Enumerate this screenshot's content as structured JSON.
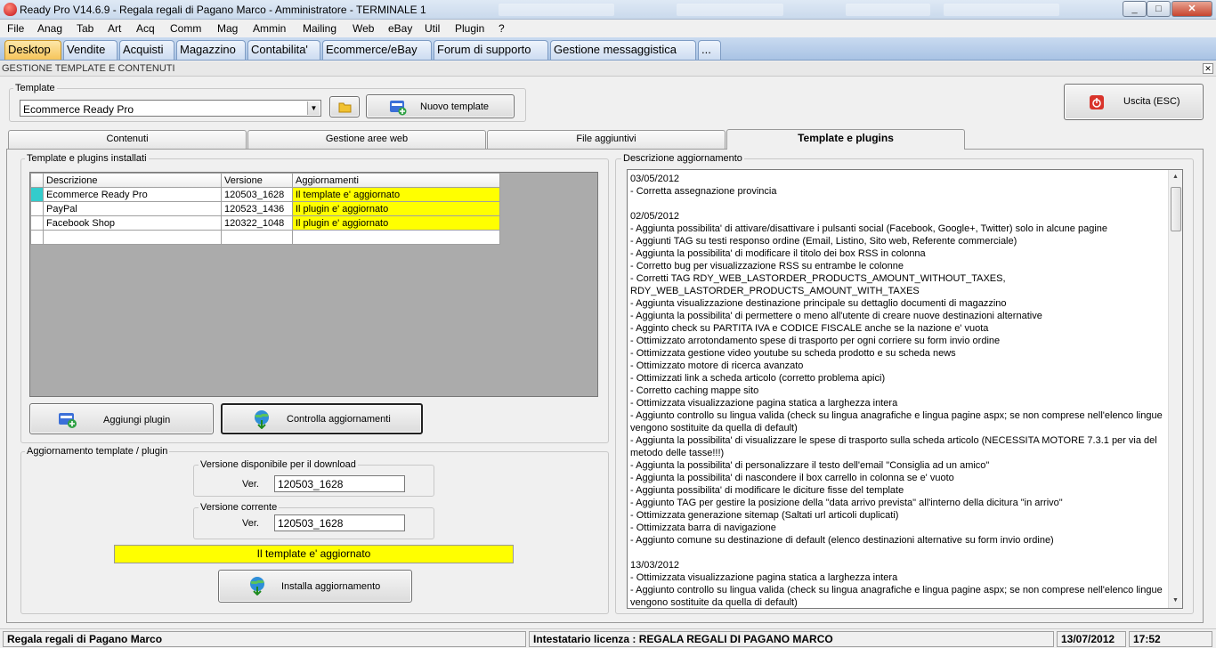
{
  "window": {
    "title": "Ready Pro V14.6.9 - Regala regali di Pagano Marco - Amministratore - TERMINALE 1",
    "controls": [
      "_",
      "□",
      "✕"
    ]
  },
  "menu": [
    "File",
    "Anag",
    "Tab",
    "Art",
    "Acq",
    "Comm",
    "Mag",
    "Ammin",
    "Mailing",
    "Web",
    "eBay",
    "Util",
    "Plugin",
    "?"
  ],
  "main_tabs": [
    "Desktop",
    "Vendite",
    "Acquisti",
    "Magazzino",
    "Contabilita'",
    "Ecommerce/eBay",
    "Forum di supporto",
    "Gestione messaggistica",
    "..."
  ],
  "section_title": "GESTIONE TEMPLATE E CONTENUTI",
  "template_group": {
    "legend": "Template",
    "selected": "Ecommerce Ready Pro",
    "new_button": "Nuovo template"
  },
  "exit_button": "Uscita (ESC)",
  "page_tabs": [
    "Contenuti",
    "Gestione aree web",
    "File aggiuntivi",
    "Template e plugins"
  ],
  "installed": {
    "legend": "Template e plugins installati",
    "columns": [
      "Descrizione",
      "Versione",
      "Aggiornamenti"
    ],
    "rows": [
      {
        "descrizione": "Ecommerce Ready Pro",
        "versione": "120503_1628",
        "aggiornamenti": "Il template e' aggiornato"
      },
      {
        "descrizione": "PayPal",
        "versione": "120523_1436",
        "aggiornamenti": "Il plugin e' aggiornato"
      },
      {
        "descrizione": "Facebook Shop",
        "versione": "120322_1048",
        "aggiornamenti": "Il plugin e' aggiornato"
      }
    ],
    "add_button": "Aggiungi plugin",
    "check_button": "Controlla aggiornamenti"
  },
  "update": {
    "legend": "Aggiornamento template / plugin",
    "available_legend": "Versione disponibile per il download",
    "current_legend": "Versione corrente",
    "ver_label": "Ver.",
    "available_value": "120503_1628",
    "current_value": "120503_1628",
    "status": "Il template e' aggiornato",
    "install_button": "Installa aggiornamento"
  },
  "description": {
    "legend": "Descrizione aggiornamento",
    "text": "03/05/2012\n- Corretta assegnazione provincia\n\n02/05/2012\n- Aggiunta possibilita' di attivare/disattivare i pulsanti social (Facebook, Google+, Twitter) solo in alcune pagine\n- Aggiunti TAG su testi responso ordine (Email, Listino, Sito web, Referente commerciale)\n- Aggiunta la possibilita' di modificare il titolo dei box RSS in colonna\n- Corretto bug per visualizzazione RSS su entrambe le colonne\n- Corretti TAG RDY_WEB_LASTORDER_PRODUCTS_AMOUNT_WITHOUT_TAXES,\nRDY_WEB_LASTORDER_PRODUCTS_AMOUNT_WITH_TAXES\n- Aggiunta visualizzazione destinazione principale su dettaglio documenti di magazzino\n- Aggiunta la possibilita' di permettere o meno all'utente di creare nuove destinazioni alternative\n- Agginto check su PARTITA IVA e CODICE FISCALE anche se la nazione e' vuota\n- Ottimizzato arrotondamento spese di trasporto per ogni corriere su form invio ordine\n- Ottimizzata gestione video youtube su scheda prodotto e su scheda news\n- Ottimizzato motore di ricerca avanzato\n- Ottimizzati link a scheda articolo (corretto problema apici)\n- Corretto caching mappe sito\n- Ottimizzata visualizzazione pagina statica a larghezza intera\n- Aggiunto controllo su lingua valida (check su lingua anagrafiche e lingua pagine aspx; se non comprese nell'elenco lingue vengono sostituite da quella di default)\n- Aggiunta la possibilita' di visualizzare le spese di trasporto sulla scheda articolo (NECESSITA MOTORE 7.3.1 per via del metodo delle tasse!!!)\n- Aggiunta la possibilita' di personalizzare il testo dell'email \"Consiglia ad un amico\"\n- Aggiunta la possibilita' di nascondere il box carrello in colonna se e' vuoto\n- Aggiunta possibilita' di modificare le diciture fisse del template\n- Aggiunto TAG per gestire la posizione della \"data arrivo prevista\" all'interno della dicitura \"in arrivo\"\n- Ottimizzata generazione sitemap (Saltati url articoli duplicati)\n- Ottimizzata barra di navigazione\n- Aggiunto comune su destinazione di default (elenco destinazioni alternative su form invio ordine)\n\n13/03/2012\n- Ottimizzata visualizzazione pagina statica a larghezza intera\n- Aggiunto controllo su lingua valida (check su lingua anagrafiche e lingua pagine aspx; se non comprese nell'elenco lingue vengono sostituite da quella di default)"
  },
  "statusbar": {
    "company": "Regala regali di Pagano Marco",
    "license": "Intestatario licenza : REGALA REGALI DI PAGANO MARCO",
    "date": "13/07/2012",
    "time": "17:52"
  },
  "colors": {
    "active_tab": "#f6c55a",
    "highlight": "#ffff00",
    "row_indicator": "#33cccc"
  }
}
